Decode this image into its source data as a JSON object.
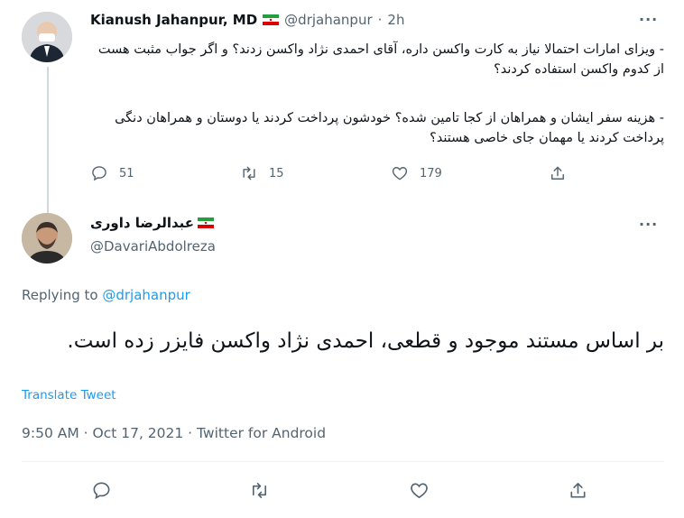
{
  "first_tweet": {
    "author_name": "Kianush Jahanpur, MD",
    "author_handle": "@drjahanpur",
    "time_separator": "·",
    "time": "2h",
    "paragraph1": "- ویزای امارات احتمالا نیاز به کارت واکسن داره، آقای احمدی نژاد واکسن زدند؟ و اگر جواب مثبت هست از کدوم واکسن استفاده کردند؟",
    "paragraph2": "- هزینه سفر ایشان و همراهان از کجا تامین شده؟ خودشون پرداخت کردند یا دوستان و همراهان دنگی پرداخت کردند یا مهمان جای خاصی هستند؟",
    "actions": {
      "reply_count": "51",
      "retweet_count": "15",
      "like_count": "179"
    }
  },
  "main_tweet": {
    "author_name": "عبدالرضا داوری",
    "author_handle": "@DavariAbdolreza",
    "replying_prefix": "Replying to",
    "replying_handle": "@drjahanpur",
    "text": "بر اساس مستند موجود و قطعی، احمدی نژاد واکسن فایزر زده است.",
    "translate_label": "Translate Tweet",
    "timestamp": "9:50 AM · Oct 17, 2021 · Twitter for Android"
  },
  "colors": {
    "accent": "#1d9bf0",
    "muted": "#536471",
    "text": "#0f1419",
    "flag_green": "#239f40",
    "flag_red": "#da0000"
  }
}
